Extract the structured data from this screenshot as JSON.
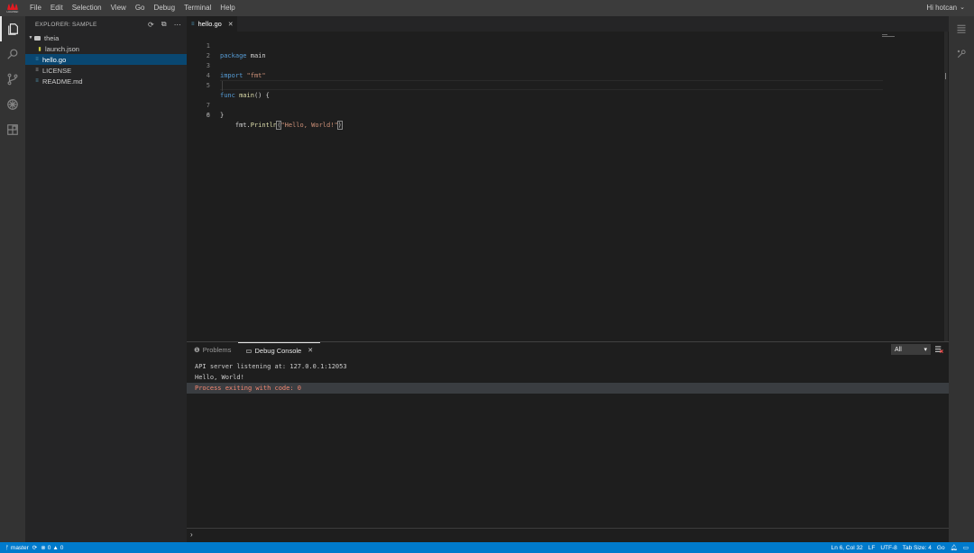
{
  "menubar": {
    "brand": "HUAWEI",
    "items": [
      "File",
      "Edit",
      "Selection",
      "View",
      "Go",
      "Debug",
      "Terminal",
      "Help"
    ],
    "user": "Hi hotcan"
  },
  "activity": [
    "explorer-icon",
    "search-icon",
    "source-control-icon",
    "debug-icon",
    "extensions-icon"
  ],
  "sidebar": {
    "title": "EXPLORER: SAMPLE",
    "tree": [
      {
        "label": "theia",
        "type": "folder",
        "depth": 0
      },
      {
        "label": "launch.json",
        "type": "json",
        "depth": 1
      },
      {
        "label": "hello.go",
        "type": "go",
        "depth": 0,
        "selected": true
      },
      {
        "label": "LICENSE",
        "type": "text",
        "depth": 0
      },
      {
        "label": "README.md",
        "type": "md",
        "depth": 0
      }
    ]
  },
  "editor": {
    "tab_label": "hello.go",
    "current_line": 6,
    "lines": [
      {
        "n": "1",
        "text": "package main"
      },
      {
        "n": "2",
        "text": ""
      },
      {
        "n": "3",
        "text": "import \"fmt\""
      },
      {
        "n": "4",
        "text": ""
      },
      {
        "n": "5",
        "text": "func main() {"
      },
      {
        "n": "6",
        "text": "    fmt.Println(\"Hello, World!\")"
      },
      {
        "n": "7",
        "text": "}"
      },
      {
        "n": "8",
        "text": ""
      }
    ]
  },
  "panel": {
    "tabs": [
      {
        "label": "Problems",
        "active": false
      },
      {
        "label": "Debug Console",
        "active": true
      }
    ],
    "filter": "All",
    "console": [
      {
        "text": "API server listening at: 127.0.0.1:12053",
        "level": "info"
      },
      {
        "text": "Hello, World!",
        "level": "info"
      },
      {
        "text": "Process exiting with code: 0",
        "level": "error"
      }
    ],
    "prompt": "›"
  },
  "statusbar": {
    "branch": "master",
    "errors": "0",
    "warnings": "0",
    "position": "Ln 6, Col 32",
    "eol": "LF",
    "encoding": "UTF-8",
    "tab_size": "Tab Size: 4",
    "language": "Go"
  },
  "colors": {
    "accent": "#007acc",
    "selection": "#094771",
    "error_text": "#f48771",
    "brand": "#e11b22"
  }
}
